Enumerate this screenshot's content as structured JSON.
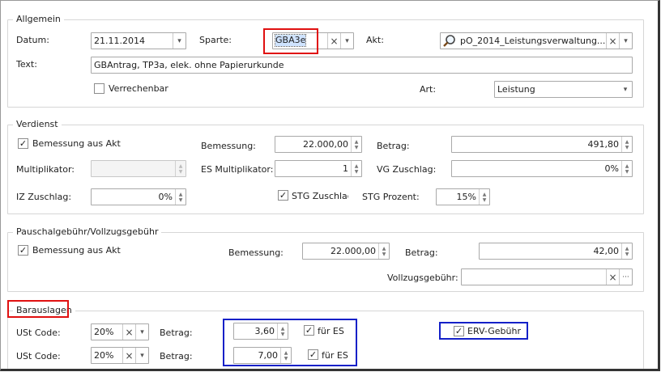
{
  "allgemein": {
    "legend": "Allgemein",
    "datum_label": "Datum:",
    "datum_value": "21.11.2014",
    "sparte_label": "Sparte:",
    "sparte_value": "GBA3e",
    "akt_label": "Akt:",
    "akt_value": "pO_2014_Leistungsverwaltung...",
    "text_label": "Text:",
    "text_value": "GBAntrag, TP3a, elek. ohne Papierurkunde",
    "verrechenbar_label": "Verrechenbar",
    "verrechenbar_checked": false,
    "art_label": "Art:",
    "art_value": "Leistung"
  },
  "verdienst": {
    "legend": "Verdienst",
    "bemessung_aus_akt_label": "Bemessung aus Akt",
    "bemessung_aus_akt_checked": true,
    "bemessung_label": "Bemessung:",
    "bemessung_value": "22.000,00",
    "betrag_label": "Betrag:",
    "betrag_value": "491,80",
    "multiplikator_label": "Multiplikator:",
    "multiplikator_value": "",
    "es_multiplikator_label": "ES Multiplikator:",
    "es_multiplikator_value": "1",
    "vg_zuschlag_label": "VG Zuschlag:",
    "vg_zuschlag_value": "0%",
    "iz_zuschlag_label": "IZ Zuschlag:",
    "iz_zuschlag_value": "0%",
    "stg_zuschlag_label": "STG Zuschlag",
    "stg_zuschlag_checked": true,
    "stg_prozent_label": "STG Prozent:",
    "stg_prozent_value": "15%"
  },
  "pauschal": {
    "legend": "Pauschalgebühr/Vollzugsgebühr",
    "bemessung_aus_akt_label": "Bemessung aus Akt",
    "bemessung_aus_akt_checked": true,
    "bemessung_label": "Bemessung:",
    "bemessung_value": "22.000,00",
    "betrag_label": "Betrag:",
    "betrag_value": "42,00",
    "vollzugsgebuehr_label": "Vollzugsgebühr:",
    "vollzugsgebuehr_value": ""
  },
  "barauslagen": {
    "legend": "Barauslagen",
    "rows": [
      {
        "ust_label": "USt Code:",
        "ust_value": "20%",
        "betrag_label": "Betrag:",
        "betrag_value": "3,60",
        "fuer_es_label": "für ES",
        "fuer_es_checked": true
      },
      {
        "ust_label": "USt Code:",
        "ust_value": "20%",
        "betrag_label": "Betrag:",
        "betrag_value": "7,00",
        "fuer_es_label": "für ES",
        "fuer_es_checked": true
      }
    ],
    "erv_label": "ERV-Gebühr",
    "erv_checked": true
  },
  "icons": {
    "check": "✓",
    "clear": "×",
    "dropdown": "▾",
    "spin_up": "▲",
    "spin_down": "▼",
    "more": "···"
  },
  "colors": {
    "highlight_red": "#e01010",
    "highlight_blue": "#1420c8",
    "selection": "#cfe3ff"
  }
}
